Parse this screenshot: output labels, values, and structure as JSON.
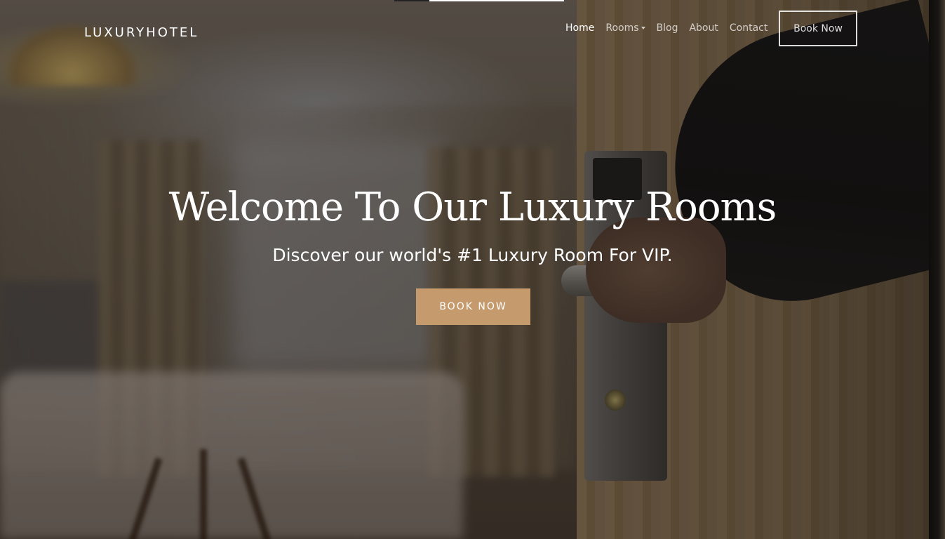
{
  "brand": {
    "name": "LUXURYHOTEL"
  },
  "nav": {
    "items": [
      {
        "label": "Home",
        "active": true
      },
      {
        "label": "Rooms",
        "dropdown": true
      },
      {
        "label": "Blog"
      },
      {
        "label": "About"
      },
      {
        "label": "Contact"
      }
    ],
    "book_label": "Book Now"
  },
  "hero": {
    "title": "Welcome To Our Luxury Rooms",
    "subtitle": "Discover our world's #1 Luxury Room For VIP.",
    "cta_label": "BOOK NOW"
  },
  "colors": {
    "accent": "#c59b6d",
    "text": "#ffffff"
  },
  "icons": {
    "rooms_dropdown": "caret-down-icon"
  }
}
